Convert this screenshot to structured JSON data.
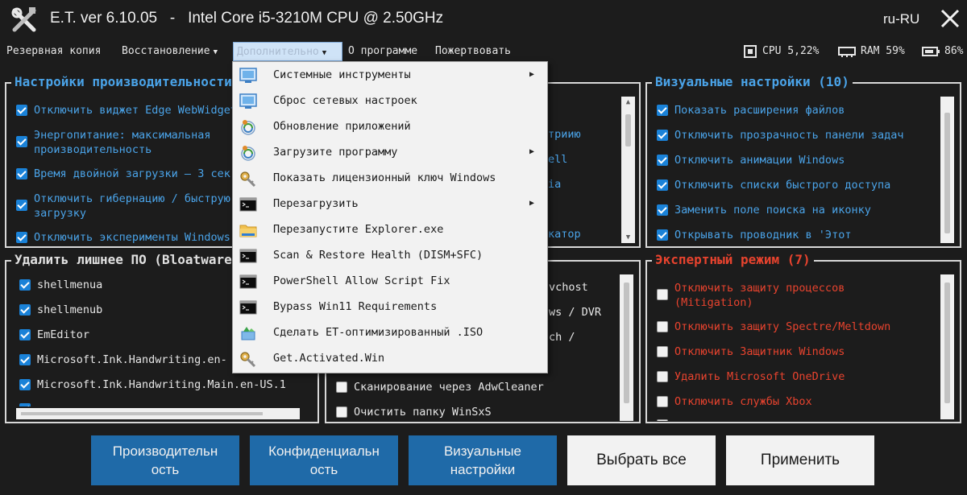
{
  "window": {
    "title": "E.T. ver 6.10.05   -   Intel Core i5-3210M CPU @ 2.50GHz",
    "language": "ru-RU"
  },
  "menu": {
    "items": [
      "Резервная копия",
      "Восстановление",
      "Дополнительно",
      "О программе",
      "Пожертвовать"
    ]
  },
  "status": {
    "cpu": "CPU 5,22%",
    "ram": "RAM 59%",
    "battery": "86%"
  },
  "panels": {
    "performance": {
      "title": "Настройки производительности",
      "items": [
        {
          "label": "Отключить виджет Edge WebWidget",
          "checked": true
        },
        {
          "label": "Энергопитание: максимальная\nпроизводительность",
          "checked": true
        },
        {
          "label": "Время двойной загрузки — 3 сек",
          "checked": true
        },
        {
          "label": "Отключить гибернацию / быструю\nзагрузку",
          "checked": true
        },
        {
          "label": "Отключить эксперименты Windows",
          "checked": true
        }
      ]
    },
    "privacy_fragments": [
      "триию",
      "ell",
      "ia",
      "катор"
    ],
    "visual": {
      "title": "Визуальные настройки (10)",
      "items": [
        {
          "label": "Показать расширения файлов",
          "checked": true
        },
        {
          "label": "Отключить прозрачность панели задач",
          "checked": true
        },
        {
          "label": "Отключить анимации Windows",
          "checked": true
        },
        {
          "label": "Отключить списки быстрого доступа",
          "checked": true
        },
        {
          "label": "Заменить поле поиска на иконку",
          "checked": true
        },
        {
          "label": "Открывать проводник в 'Этот",
          "checked": true
        }
      ]
    },
    "bloatware": {
      "title": "Удалить лишнее ПО (Bloatware",
      "items": [
        {
          "label": "shellmenua",
          "checked": true
        },
        {
          "label": "shellmenub",
          "checked": true
        },
        {
          "label": "EmEditor",
          "checked": true
        },
        {
          "label": "Microsoft.Ink.Handwriting.en-",
          "checked": true
        },
        {
          "label": "Microsoft.Ink.Handwriting.Main.en-US.1",
          "checked": true
        }
      ]
    },
    "misc": {
      "fragments": [
        "vchost",
        "ws / DVR",
        "ch /"
      ],
      "items": [
        {
          "label": "Сканирование через AdwCleaner",
          "checked": false
        },
        {
          "label": "Очистить папку WinSxS",
          "checked": false
        }
      ]
    },
    "expert": {
      "title": "Экспертный режим (7)",
      "items": [
        {
          "label": "Отключить защиту процессов\n(Mitigation)",
          "checked": false
        },
        {
          "label": "Отключить защиту Spectre/Meltdown",
          "checked": false
        },
        {
          "label": "Отключить Защитник Windows",
          "checked": false
        },
        {
          "label": "Удалить Microsoft OneDrive",
          "checked": false
        },
        {
          "label": "Отключить службы Xbox",
          "checked": false
        }
      ]
    }
  },
  "dropdown": {
    "items": [
      {
        "label": "Системные инструменты",
        "icon": "system-tools-icon",
        "submenu": true
      },
      {
        "label": "Сброс сетевых настроек",
        "icon": "network-reset-icon",
        "submenu": false
      },
      {
        "label": "Обновление приложений",
        "icon": "update-icon",
        "submenu": false
      },
      {
        "label": "Загрузите программу",
        "icon": "download-icon",
        "submenu": true
      },
      {
        "label": "Показать лицензионный ключ Windows",
        "icon": "key-icon",
        "submenu": false
      },
      {
        "label": "Перезагрузить",
        "icon": "console-icon",
        "submenu": true
      },
      {
        "label": "Перезапустите Explorer.exe",
        "icon": "folder-icon",
        "submenu": false
      },
      {
        "label": "Scan & Restore Health (DISM+SFC)",
        "icon": "console-icon",
        "submenu": false
      },
      {
        "label": "PowerShell Allow Script Fix",
        "icon": "console-icon",
        "submenu": false
      },
      {
        "label": "Bypass Win11 Requirements",
        "icon": "console-icon",
        "submenu": false
      },
      {
        "label": "Сделать ET-оптимизированный .ISO",
        "icon": "iso-icon",
        "submenu": false
      },
      {
        "label": "Get.Activated.Win",
        "icon": "key-icon",
        "submenu": false
      }
    ]
  },
  "buttons": {
    "performance": "Производительн\nость",
    "privacy": "Конфиденциальн\nость",
    "visual": "Визуальные\nнастройки",
    "select_all": "Выбрать все",
    "apply": "Применить"
  },
  "colors": {
    "background": "#1c1c1c",
    "accent_blue": "#4aa3e8",
    "expert_red": "#e8432e",
    "button_blue": "#1f6aa8",
    "checkbox_blue": "#1a82d8"
  }
}
